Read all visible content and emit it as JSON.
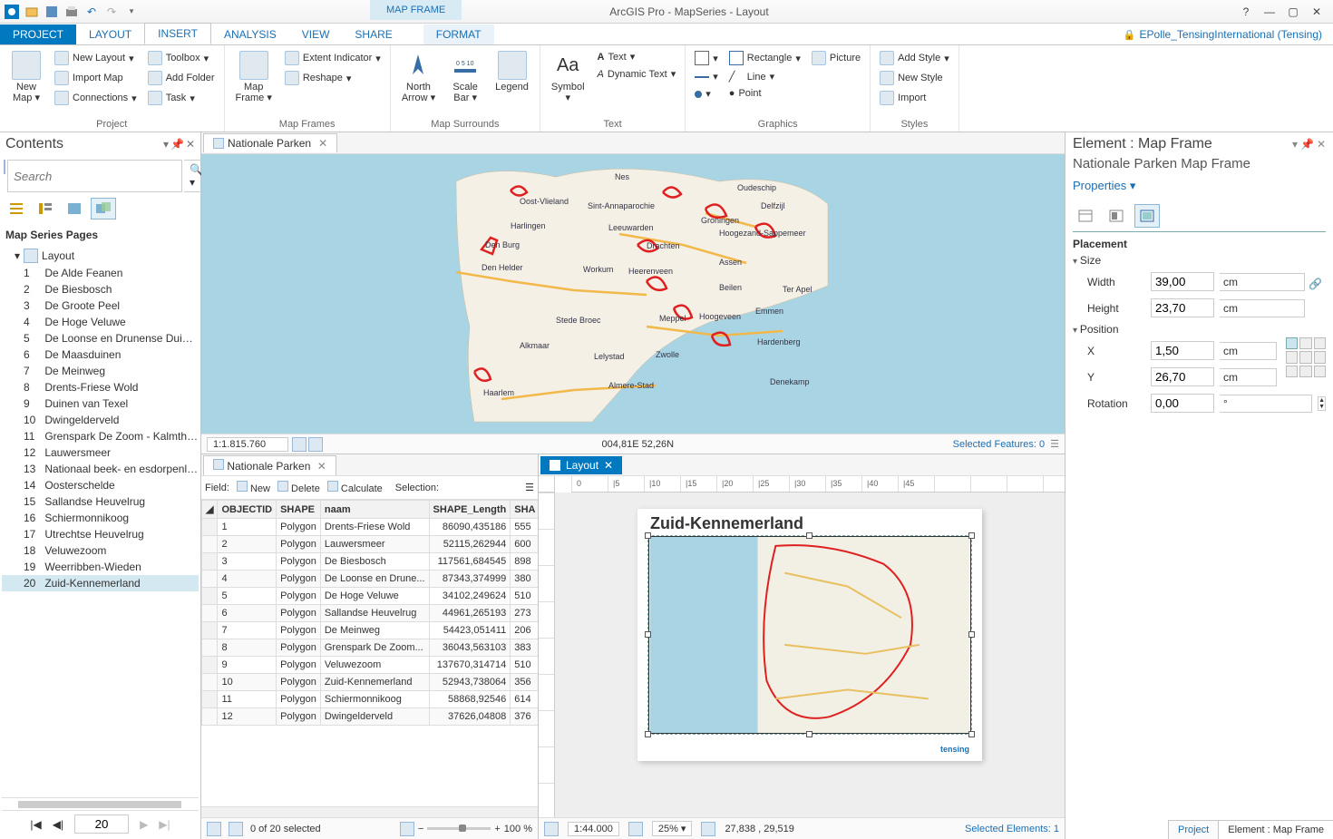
{
  "title": "ArcGIS Pro - MapSeries - Layout",
  "context_tab": "MAP FRAME",
  "user": "EPolle_TensingInternational (Tensing)",
  "tabs": [
    "PROJECT",
    "LAYOUT",
    "INSERT",
    "ANALYSIS",
    "VIEW",
    "SHARE"
  ],
  "active_tab": "INSERT",
  "context_sub": "FORMAT",
  "ribbon": {
    "project": {
      "label": "Project",
      "new_map": "New\nMap",
      "new_layout": "New Layout",
      "import_map": "Import Map",
      "connections": "Connections",
      "toolbox": "Toolbox",
      "add_folder": "Add Folder",
      "task": "Task"
    },
    "mapframes": {
      "label": "Map Frames",
      "map_frame": "Map\nFrame",
      "extent": "Extent Indicator",
      "reshape": "Reshape"
    },
    "surrounds": {
      "label": "Map Surrounds",
      "north": "North\nArrow",
      "scalebar": "Scale\nBar",
      "legend": "Legend"
    },
    "text": {
      "label": "Text",
      "symbol": "Symbol",
      "text": "Text",
      "dynamic": "Dynamic Text"
    },
    "graphics": {
      "label": "Graphics",
      "rectangle": "Rectangle",
      "picture": "Picture",
      "line": "Line",
      "point": "Point"
    },
    "styles": {
      "label": "Styles",
      "add": "Add Style",
      "new": "New Style",
      "import": "Import"
    }
  },
  "contents": {
    "title": "Contents",
    "search_ph": "Search",
    "section": "Map Series Pages",
    "root": "Layout",
    "pages": [
      {
        "n": "1",
        "name": "De Alde Feanen"
      },
      {
        "n": "2",
        "name": "De Biesbosch"
      },
      {
        "n": "3",
        "name": "De Groote Peel"
      },
      {
        "n": "4",
        "name": "De Hoge Veluwe"
      },
      {
        "n": "5",
        "name": "De Loonse en Drunense Duinen"
      },
      {
        "n": "6",
        "name": "De Maasduinen"
      },
      {
        "n": "7",
        "name": "De Meinweg"
      },
      {
        "n": "8",
        "name": "Drents-Friese Wold"
      },
      {
        "n": "9",
        "name": "Duinen van Texel"
      },
      {
        "n": "10",
        "name": "Dwingelderveld"
      },
      {
        "n": "11",
        "name": "Grenspark De Zoom - Kalmthoutse"
      },
      {
        "n": "12",
        "name": "Lauwersmeer"
      },
      {
        "n": "13",
        "name": "Nationaal beek- en esdorpenlands"
      },
      {
        "n": "14",
        "name": "Oosterschelde"
      },
      {
        "n": "15",
        "name": "Sallandse Heuvelrug"
      },
      {
        "n": "16",
        "name": "Schiermonnikoog"
      },
      {
        "n": "17",
        "name": "Utrechtse Heuvelrug"
      },
      {
        "n": "18",
        "name": "Veluwezoom"
      },
      {
        "n": "19",
        "name": "Weerribben-Wieden"
      },
      {
        "n": "20",
        "name": "Zuid-Kennemerland"
      }
    ],
    "current_page": "20"
  },
  "mapview": {
    "tab": "Nationale Parken",
    "scale": "1:1.815.760",
    "coord": "004,81E 52,26N",
    "selected": "Selected Features: 0",
    "cities": [
      "Nes",
      "Oudeschip",
      "Delfzijl",
      "Oost-Vlieland",
      "Sint-Annaparochie",
      "Harlingen",
      "Leeuwarden",
      "Groningen",
      "Hoogezand-Sappemeer",
      "Drachten",
      "Assen",
      "Den Burg",
      "Workum",
      "Heerenveen",
      "Beilen",
      "Ter Apel",
      "Den Helder",
      "Emmen",
      "Stede Broec",
      "Meppel",
      "Hoogeveen",
      "Alkmaar",
      "Hardenberg",
      "Lelystad",
      "Zwolle",
      "Almere-Stad",
      "Denekamp",
      "Haarlem"
    ]
  },
  "table": {
    "tab": "Nationale Parken",
    "field_lbl": "Field:",
    "new": "New",
    "delete": "Delete",
    "calculate": "Calculate",
    "selection": "Selection:",
    "columns": [
      "OBJECTID",
      "SHAPE",
      "naam",
      "SHAPE_Length",
      "SHA"
    ],
    "rows": [
      {
        "id": "1",
        "shape": "Polygon",
        "naam": "Drents-Friese Wold",
        "len": "86090,435186",
        "s": "555"
      },
      {
        "id": "2",
        "shape": "Polygon",
        "naam": "Lauwersmeer",
        "len": "52115,262944",
        "s": "600"
      },
      {
        "id": "3",
        "shape": "Polygon",
        "naam": "De Biesbosch",
        "len": "117561,684545",
        "s": "898"
      },
      {
        "id": "4",
        "shape": "Polygon",
        "naam": "De Loonse en Drune...",
        "len": "87343,374999",
        "s": "380"
      },
      {
        "id": "5",
        "shape": "Polygon",
        "naam": "De Hoge Veluwe",
        "len": "34102,249624",
        "s": "510"
      },
      {
        "id": "6",
        "shape": "Polygon",
        "naam": "Sallandse Heuvelrug",
        "len": "44961,265193",
        "s": "273"
      },
      {
        "id": "7",
        "shape": "Polygon",
        "naam": "De Meinweg",
        "len": "54423,051411",
        "s": "206"
      },
      {
        "id": "8",
        "shape": "Polygon",
        "naam": "Grenspark De Zoom...",
        "len": "36043,563103",
        "s": "383"
      },
      {
        "id": "9",
        "shape": "Polygon",
        "naam": "Veluwezoom",
        "len": "137670,314714",
        "s": "510"
      },
      {
        "id": "10",
        "shape": "Polygon",
        "naam": "Zuid-Kennemerland",
        "len": "52943,738064",
        "s": "356"
      },
      {
        "id": "11",
        "shape": "Polygon",
        "naam": "Schiermonnikoog",
        "len": "58868,92546",
        "s": "614"
      },
      {
        "id": "12",
        "shape": "Polygon",
        "naam": "Dwingelderveld",
        "len": "37626,04808",
        "s": "376"
      }
    ],
    "footer": "0 of 20 selected",
    "zoom": "100 %"
  },
  "layout": {
    "tab": "Layout",
    "title": "Zuid-Kennemerland",
    "scale": "1:44.000",
    "pct": "25%",
    "coord": "27,838 , 29,519",
    "sel": "Selected Elements: 1"
  },
  "element": {
    "title": "Element : Map Frame",
    "sub": "Nationale Parken Map Frame",
    "link": "Properties",
    "placement": "Placement",
    "size": "Size",
    "position": "Position",
    "width_lbl": "Width",
    "width": "39,00",
    "width_u": "cm",
    "height_lbl": "Height",
    "height": "23,70",
    "height_u": "cm",
    "x_lbl": "X",
    "x": "1,50",
    "x_u": "cm",
    "y_lbl": "Y",
    "y": "26,70",
    "y_u": "cm",
    "rot_lbl": "Rotation",
    "rot": "0,00",
    "rot_u": "°",
    "btm_tabs": [
      "Project",
      "Element : Map Frame"
    ]
  }
}
